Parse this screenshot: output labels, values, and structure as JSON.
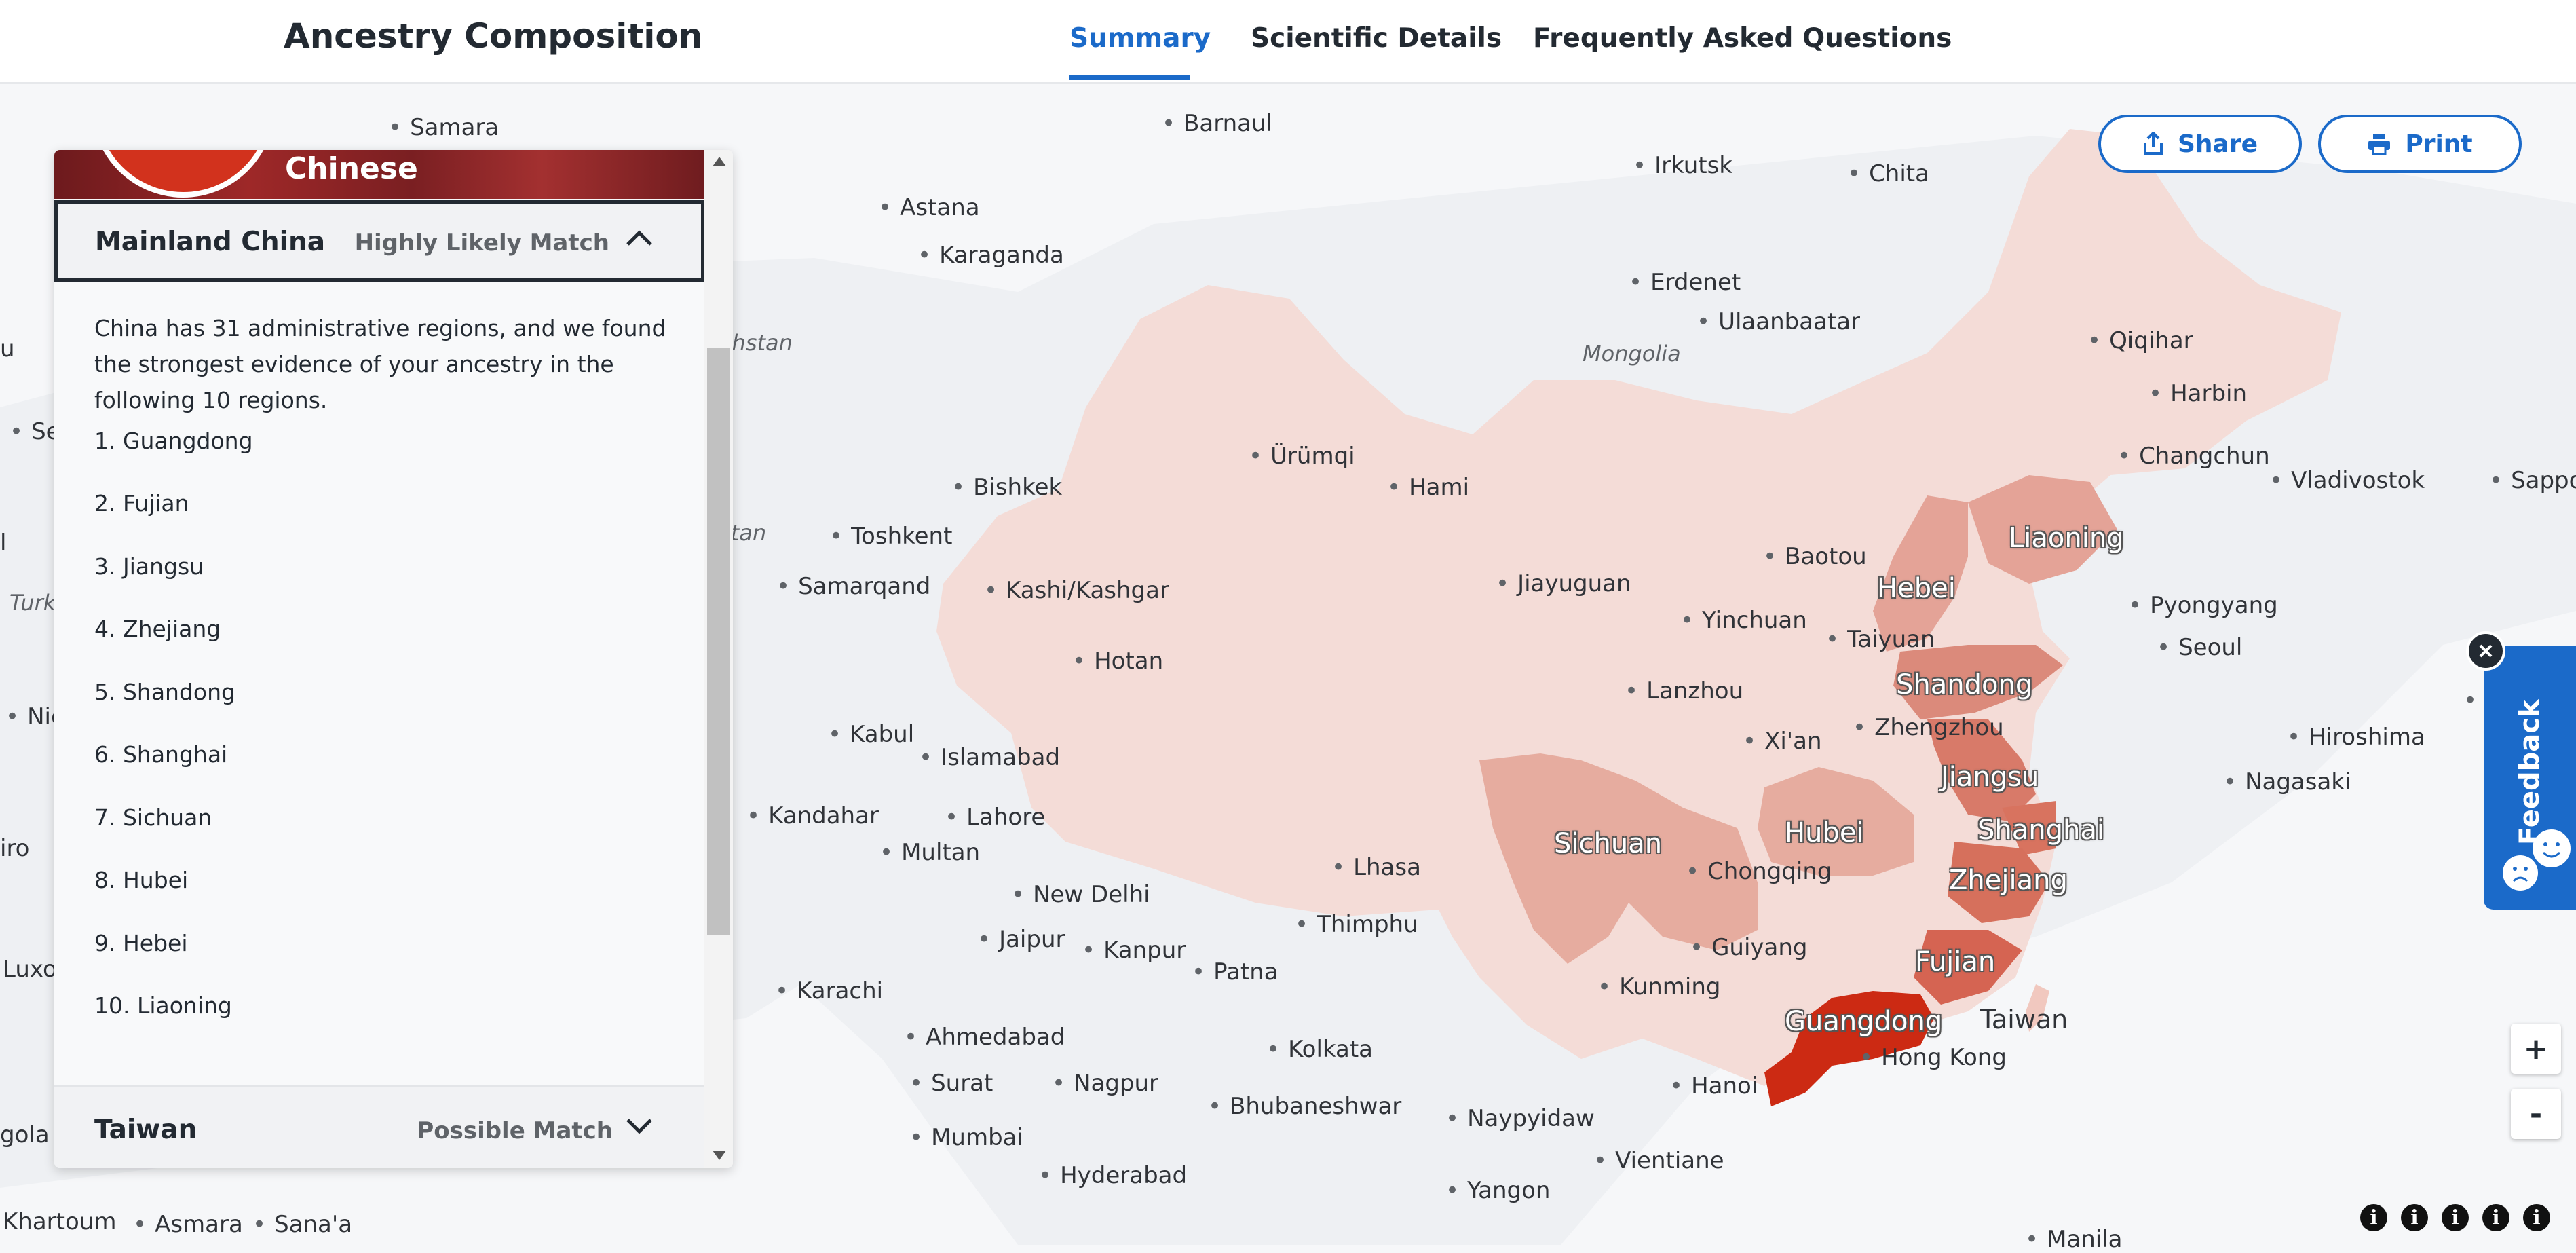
{
  "header": {
    "title": "Ancestry Composition",
    "tabs": [
      {
        "label": "Summary",
        "active": true
      },
      {
        "label": "Scientific Details",
        "active": false
      },
      {
        "label": "Frequently Asked Questions",
        "active": false
      }
    ]
  },
  "actions": {
    "share": "Share",
    "print": "Print"
  },
  "panel": {
    "population": "Chinese",
    "region": {
      "name": "Mainland China",
      "match": "Highly Likely Match"
    },
    "description": "China has 31 administrative regions, and we found the strongest evidence of your ancestry in the following 10 regions.",
    "regions": [
      "1. Guangdong",
      "2. Fujian",
      "3. Jiangsu",
      "4. Zhejiang",
      "5. Shandong",
      "6. Shanghai",
      "7. Sichuan",
      "8. Hubei",
      "9. Hebei",
      "10. Liaoning"
    ],
    "next_region": {
      "name": "Taiwan",
      "match": "Possible Match"
    }
  },
  "feedback": {
    "label": "Feedback"
  },
  "zoom": {
    "in": "+",
    "out": "-"
  },
  "info_icon_glyph": "i",
  "map": {
    "highlight_labels": [
      "Liaoning",
      "Hebei",
      "Shandong",
      "Jiangsu",
      "Shanghai",
      "Zhejiang",
      "Fujian",
      "Guangdong",
      "Sichuan",
      "Hubei"
    ],
    "place_labels": [
      "Taiwan"
    ],
    "countries": [
      "Mongolia",
      "khstan",
      "stan",
      "Turk"
    ],
    "cities": [
      "Samara",
      "Barnaul",
      "Irkutsk",
      "Chita",
      "Astana",
      "Karaganda",
      "Erdenet",
      "Ulaanbaatar",
      "Qiqihar",
      "Harbin",
      "Changchun",
      "Vladivostok",
      "Sappo",
      "Bishkek",
      "Ürümqi",
      "Hami",
      "Toshkent",
      "Samarqand",
      "Kashi/Kashgar",
      "Jiayuguan",
      "Baotou",
      "Yinchuan",
      "Taiyuan",
      "Pyongyang",
      "Seoul",
      "Hotan",
      "Lanzhou",
      "Zhengzhou",
      "Xi'an",
      "Kabul",
      "Islamabad",
      "Hiroshima",
      "Nagasaki",
      "Kandahar",
      "Lahore",
      "Multan",
      "Lhasa",
      "Chongqing",
      "New Delhi",
      "Jaipur",
      "Kanpur",
      "Thimphu",
      "Guiyang",
      "Patna",
      "Kunming",
      "Karachi",
      "Ahmedabad",
      "Kolkata",
      "Hong Kong",
      "Surat",
      "Nagpur",
      "Hanoi",
      "Bhubaneshwar",
      "Naypyidaw",
      "Mumbai",
      "Vientiane",
      "Hyderabad",
      "Yangon",
      "Khartoum",
      "Asmara",
      "Sana'a",
      "Manila",
      "Sev",
      "Nic",
      "iro",
      "Luxo",
      "gola",
      "u",
      "l",
      "T"
    ]
  }
}
